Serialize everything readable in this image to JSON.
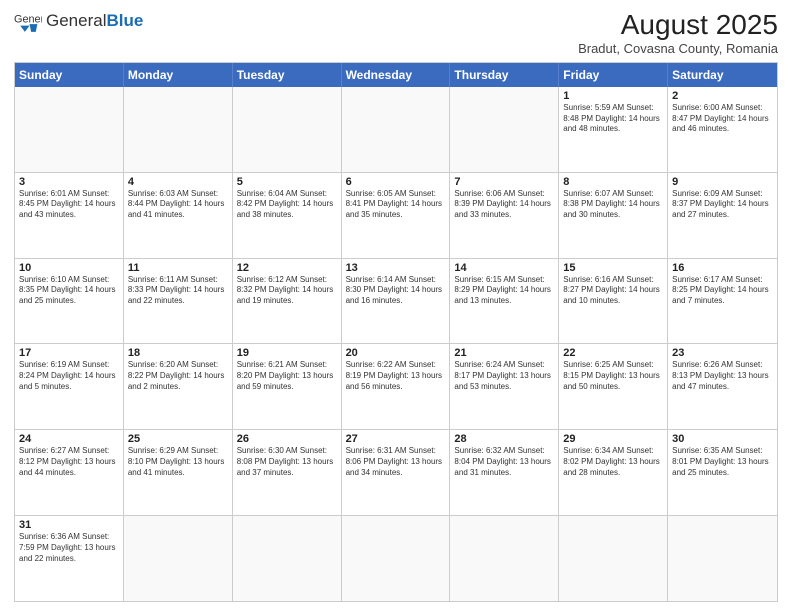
{
  "header": {
    "logo_general": "General",
    "logo_blue": "Blue",
    "month_year": "August 2025",
    "location": "Bradut, Covasna County, Romania"
  },
  "days_of_week": [
    "Sunday",
    "Monday",
    "Tuesday",
    "Wednesday",
    "Thursday",
    "Friday",
    "Saturday"
  ],
  "weeks": [
    [
      {
        "day": "",
        "info": ""
      },
      {
        "day": "",
        "info": ""
      },
      {
        "day": "",
        "info": ""
      },
      {
        "day": "",
        "info": ""
      },
      {
        "day": "",
        "info": ""
      },
      {
        "day": "1",
        "info": "Sunrise: 5:59 AM\nSunset: 8:48 PM\nDaylight: 14 hours and 48 minutes."
      },
      {
        "day": "2",
        "info": "Sunrise: 6:00 AM\nSunset: 8:47 PM\nDaylight: 14 hours and 46 minutes."
      }
    ],
    [
      {
        "day": "3",
        "info": "Sunrise: 6:01 AM\nSunset: 8:45 PM\nDaylight: 14 hours and 43 minutes."
      },
      {
        "day": "4",
        "info": "Sunrise: 6:03 AM\nSunset: 8:44 PM\nDaylight: 14 hours and 41 minutes."
      },
      {
        "day": "5",
        "info": "Sunrise: 6:04 AM\nSunset: 8:42 PM\nDaylight: 14 hours and 38 minutes."
      },
      {
        "day": "6",
        "info": "Sunrise: 6:05 AM\nSunset: 8:41 PM\nDaylight: 14 hours and 35 minutes."
      },
      {
        "day": "7",
        "info": "Sunrise: 6:06 AM\nSunset: 8:39 PM\nDaylight: 14 hours and 33 minutes."
      },
      {
        "day": "8",
        "info": "Sunrise: 6:07 AM\nSunset: 8:38 PM\nDaylight: 14 hours and 30 minutes."
      },
      {
        "day": "9",
        "info": "Sunrise: 6:09 AM\nSunset: 8:37 PM\nDaylight: 14 hours and 27 minutes."
      }
    ],
    [
      {
        "day": "10",
        "info": "Sunrise: 6:10 AM\nSunset: 8:35 PM\nDaylight: 14 hours and 25 minutes."
      },
      {
        "day": "11",
        "info": "Sunrise: 6:11 AM\nSunset: 8:33 PM\nDaylight: 14 hours and 22 minutes."
      },
      {
        "day": "12",
        "info": "Sunrise: 6:12 AM\nSunset: 8:32 PM\nDaylight: 14 hours and 19 minutes."
      },
      {
        "day": "13",
        "info": "Sunrise: 6:14 AM\nSunset: 8:30 PM\nDaylight: 14 hours and 16 minutes."
      },
      {
        "day": "14",
        "info": "Sunrise: 6:15 AM\nSunset: 8:29 PM\nDaylight: 14 hours and 13 minutes."
      },
      {
        "day": "15",
        "info": "Sunrise: 6:16 AM\nSunset: 8:27 PM\nDaylight: 14 hours and 10 minutes."
      },
      {
        "day": "16",
        "info": "Sunrise: 6:17 AM\nSunset: 8:25 PM\nDaylight: 14 hours and 7 minutes."
      }
    ],
    [
      {
        "day": "17",
        "info": "Sunrise: 6:19 AM\nSunset: 8:24 PM\nDaylight: 14 hours and 5 minutes."
      },
      {
        "day": "18",
        "info": "Sunrise: 6:20 AM\nSunset: 8:22 PM\nDaylight: 14 hours and 2 minutes."
      },
      {
        "day": "19",
        "info": "Sunrise: 6:21 AM\nSunset: 8:20 PM\nDaylight: 13 hours and 59 minutes."
      },
      {
        "day": "20",
        "info": "Sunrise: 6:22 AM\nSunset: 8:19 PM\nDaylight: 13 hours and 56 minutes."
      },
      {
        "day": "21",
        "info": "Sunrise: 6:24 AM\nSunset: 8:17 PM\nDaylight: 13 hours and 53 minutes."
      },
      {
        "day": "22",
        "info": "Sunrise: 6:25 AM\nSunset: 8:15 PM\nDaylight: 13 hours and 50 minutes."
      },
      {
        "day": "23",
        "info": "Sunrise: 6:26 AM\nSunset: 8:13 PM\nDaylight: 13 hours and 47 minutes."
      }
    ],
    [
      {
        "day": "24",
        "info": "Sunrise: 6:27 AM\nSunset: 8:12 PM\nDaylight: 13 hours and 44 minutes."
      },
      {
        "day": "25",
        "info": "Sunrise: 6:29 AM\nSunset: 8:10 PM\nDaylight: 13 hours and 41 minutes."
      },
      {
        "day": "26",
        "info": "Sunrise: 6:30 AM\nSunset: 8:08 PM\nDaylight: 13 hours and 37 minutes."
      },
      {
        "day": "27",
        "info": "Sunrise: 6:31 AM\nSunset: 8:06 PM\nDaylight: 13 hours and 34 minutes."
      },
      {
        "day": "28",
        "info": "Sunrise: 6:32 AM\nSunset: 8:04 PM\nDaylight: 13 hours and 31 minutes."
      },
      {
        "day": "29",
        "info": "Sunrise: 6:34 AM\nSunset: 8:02 PM\nDaylight: 13 hours and 28 minutes."
      },
      {
        "day": "30",
        "info": "Sunrise: 6:35 AM\nSunset: 8:01 PM\nDaylight: 13 hours and 25 minutes."
      }
    ],
    [
      {
        "day": "31",
        "info": "Sunrise: 6:36 AM\nSunset: 7:59 PM\nDaylight: 13 hours and 22 minutes."
      },
      {
        "day": "",
        "info": ""
      },
      {
        "day": "",
        "info": ""
      },
      {
        "day": "",
        "info": ""
      },
      {
        "day": "",
        "info": ""
      },
      {
        "day": "",
        "info": ""
      },
      {
        "day": "",
        "info": ""
      }
    ]
  ]
}
